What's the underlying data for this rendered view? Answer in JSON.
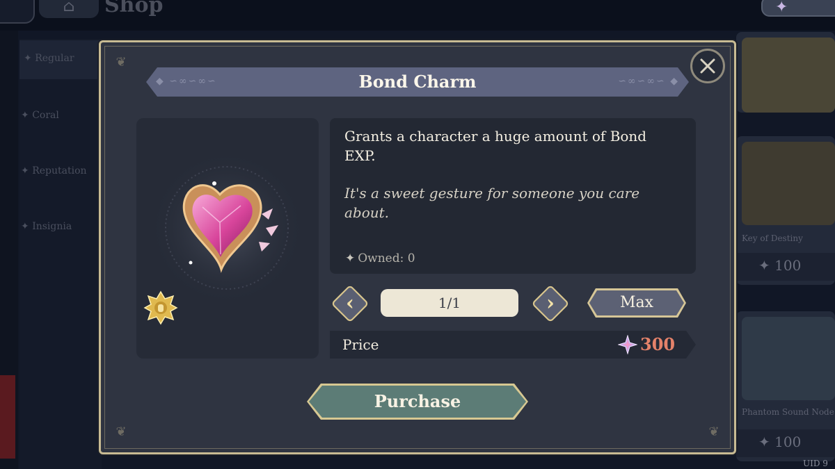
{
  "background": {
    "shop_title": "Shop",
    "sidebar_items": [
      "Regular",
      "Coral",
      "Reputation",
      "Insignia"
    ],
    "cards": [
      {
        "name": "Key of Destiny",
        "price": "100"
      },
      {
        "name": "Phantom Sound Node",
        "price": "100"
      }
    ],
    "uid_label": "UID 9"
  },
  "dialog": {
    "title": "Bond Charm",
    "description": "Grants a character a huge amount of Bond EXP.",
    "flavor_text": "It's a sweet gesture for someone you care about.",
    "owned_label": "Owned: 0",
    "quantity": "1/1",
    "max_label": "Max",
    "price_label": "Price",
    "price_value": "300",
    "purchase_label": "Purchase"
  },
  "icons": {
    "close": "close-icon",
    "decrease": "chevron-left-icon",
    "increase": "chevron-right-icon",
    "currency": "star-crystal-icon",
    "item": "heart-gem-icon",
    "rarity": "gold-rarity-badge"
  },
  "colors": {
    "modal_bg": "#2f3441",
    "border_gold": "#c8bb93",
    "title_bar": "#5e6480",
    "price_accent": "#e4826a",
    "purchase_button": "#5c7c76",
    "quantity_field": "#ede7d6"
  }
}
